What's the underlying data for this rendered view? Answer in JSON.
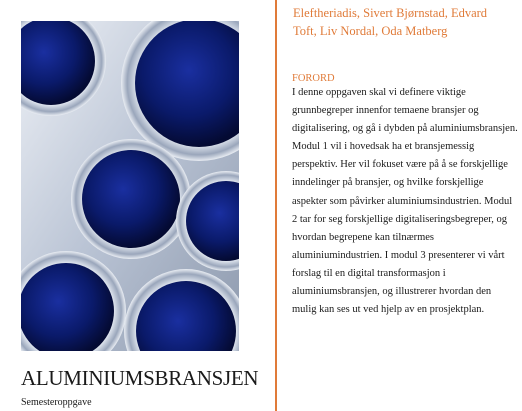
{
  "cover": {
    "image": "aluminium-pipes-photo",
    "title": "ALUMINIUMSBRANSJEN",
    "subtitle": "Semesteroppgave"
  },
  "authors": "Eleftheriadis, Sivert Bjørnstad, Edvard Toft, Liv Nordal, Oda Matberg",
  "foreword": {
    "heading": "FORORD",
    "text": "I denne oppgaven skal vi definere viktige grunnbegreper innenfor temaene bransjer og digitalisering, og gå i dybden på aluminiumsbransjen. Modul 1 vil i hovedsak ha et bransjemessig perspektiv. Her vil fokuset være på å se forskjellige inndelinger på bransjer, og hvilke forskjellige aspekter som påvirker aluminiumsindustrien. Modul 2 tar for seg forskjellige digitaliseringsbegreper, og hvordan begrepene kan tilnærmes aluminiumindustrien. I modul 3 presenterer vi vårt forslag til en digital transformasjon i aluminiumsbransjen, og illustrerer hvordan den mulig kan ses ut ved hjelp av en prosjektplan."
  },
  "colors": {
    "accent": "#e07b39",
    "pipe_inner": "#0a1a6a"
  }
}
